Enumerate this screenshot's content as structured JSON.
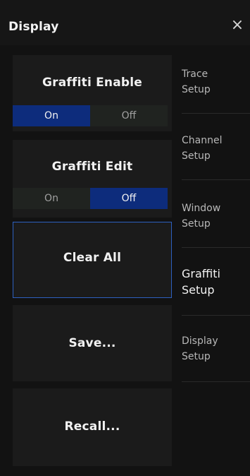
{
  "header": {
    "title": "Display",
    "close_icon": "close-icon",
    "close_glyph": "×"
  },
  "left": {
    "graffiti_enable": {
      "title": "Graffiti Enable",
      "on_label": "On",
      "off_label": "Off",
      "selected": "On"
    },
    "graffiti_edit": {
      "title": "Graffiti Edit",
      "on_label": "On",
      "off_label": "Off",
      "selected": "Off"
    },
    "clear_all_label": "Clear All",
    "save_label": "Save...",
    "recall_label": "Recall..."
  },
  "tabs": [
    {
      "label_line1": "Trace",
      "label_line2": "Setup",
      "active": false
    },
    {
      "label_line1": "Channel",
      "label_line2": "Setup",
      "active": false
    },
    {
      "label_line1": "Window",
      "label_line2": "Setup",
      "active": false
    },
    {
      "label_line1": "Graffiti",
      "label_line2": "Setup",
      "active": true
    },
    {
      "label_line1": "Display",
      "label_line2": "Setup",
      "active": false
    }
  ],
  "colors": {
    "accent": "#0d2c7c",
    "selection_border": "#2d60c0"
  }
}
